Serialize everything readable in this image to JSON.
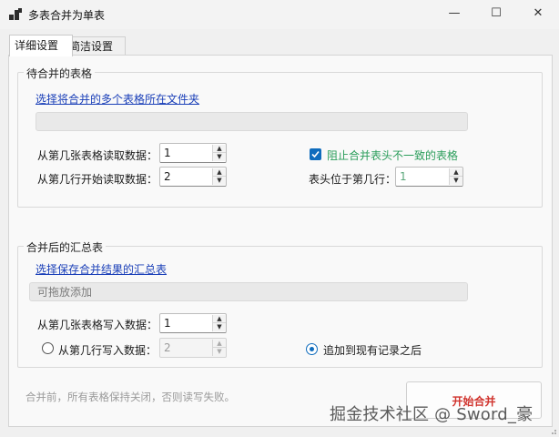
{
  "window": {
    "title": "多表合并为单表",
    "min_symbol": "—",
    "max_symbol": "☐",
    "close_symbol": "✕"
  },
  "tabs": [
    {
      "label": "详细设置",
      "active": true
    },
    {
      "label": "简洁设置",
      "active": false
    }
  ],
  "source_group": {
    "legend": "待合并的表格",
    "select_link": "选择将合并的多个表格所在文件夹",
    "path_value": "",
    "start_table_label": "从第几张表格读取数据：",
    "start_table_value": "1",
    "start_row_label": "从第几行开始读取数据：",
    "start_row_value": "2",
    "block_mismatch_label": "阻止合并表头不一致的表格",
    "block_mismatch_checked": true,
    "header_row_label": "表头位于第几行：",
    "header_row_value": "1"
  },
  "target_group": {
    "legend": "合并后的汇总表",
    "select_link": "选择保存合并结果的汇总表",
    "path_placeholder": "可拖放添加",
    "write_table_label": "从第几张表格写入数据：",
    "write_table_value": "1",
    "write_row_label": "从第几行写入数据：",
    "write_row_value": "2",
    "write_row_selected": false,
    "append_label": "追加到现有记录之后",
    "append_selected": true
  },
  "footer": {
    "note": "合并前，所有表格保持关闭，否则读写失败。",
    "start_button": "开始合并",
    "watermark": "掘金技术社区 @ Sword_豪"
  },
  "colors": {
    "accent": "#0f6cbd",
    "link": "#1a3fb8",
    "start_text": "#d0332d",
    "checkbox_label": "#2a9d5a"
  }
}
